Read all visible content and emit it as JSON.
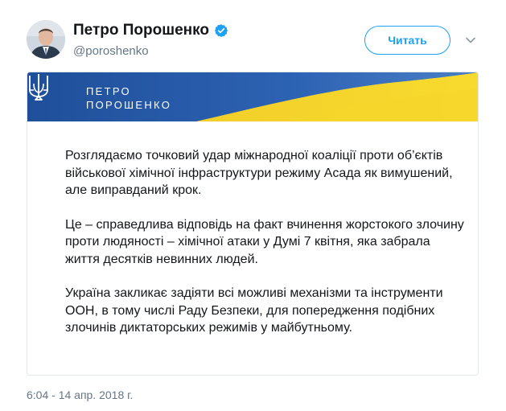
{
  "author": {
    "name": "Петро Порошенко",
    "handle": "@poroshenko",
    "verified": true
  },
  "follow_button": {
    "label": "Читать",
    "color": "#1da1f2"
  },
  "icons": {
    "verified": "verified-badge-icon",
    "caret": "chevron-down-icon",
    "trident": "trident-icon"
  },
  "banner": {
    "line1": "ПЕТРО",
    "line2": "ПОРОШЕНКО",
    "colors": {
      "blue": "#2a5caa",
      "yellow": "#f5d327"
    }
  },
  "statement": {
    "paragraphs": [
      "Розглядаємо точковий удар міжнародної коаліції проти об’єктів військової хімічної інфраструктури режиму Асада як вимушений, але виправданий крок.",
      "Це – справедлива відповідь на факт вчинення жорстокого злочину проти людяності – хімічної атаки у Думі 7 квітня, яка забрала життя десятків невинних людей.",
      "Україна закликає задіяти всі можливі механізми та інструменти ООН, в тому числі Раду Безпеки, для попередження подібних злочинів диктаторських режимів у майбутньому."
    ]
  },
  "timestamp": "6:04 - 14 апр. 2018 г."
}
